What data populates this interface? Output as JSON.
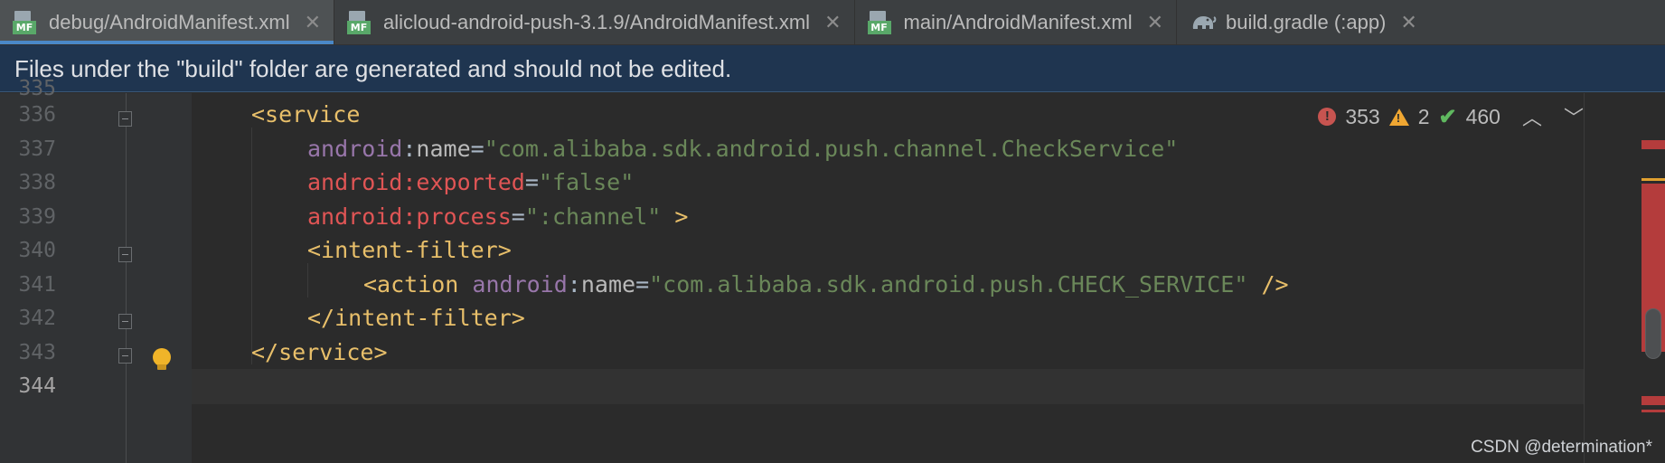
{
  "tabs": [
    {
      "label": "debug/AndroidManifest.xml",
      "icon": "manifest-file-icon",
      "active": true
    },
    {
      "label": "alicloud-android-push-3.1.9/AndroidManifest.xml",
      "icon": "manifest-file-icon",
      "active": false
    },
    {
      "label": "main/AndroidManifest.xml",
      "icon": "manifest-file-icon",
      "active": false
    },
    {
      "label": "build.gradle (:app)",
      "icon": "gradle-elephant-icon",
      "active": false
    }
  ],
  "tab_icon_badge": "MF",
  "close_glyph": "✕",
  "banner": {
    "text": "Files under the \"build\" folder are generated and should not be edited."
  },
  "line_numbers": [
    "335",
    "336",
    "337",
    "338",
    "339",
    "340",
    "341",
    "342",
    "343",
    "344"
  ],
  "code": {
    "l336": {
      "tag": "<service"
    },
    "l337": {
      "ns": "android",
      "colon": ":",
      "attr": "name",
      "eq": "=",
      "val": "\"com.alibaba.sdk.android.push.channel.CheckService\""
    },
    "l338": {
      "err": "android:exported",
      "eq": "=",
      "val": "\"false\""
    },
    "l339": {
      "err": "android:process",
      "eq": "=",
      "val": "\":channel\"",
      "close": " >"
    },
    "l340": {
      "tag": "<intent-filter>"
    },
    "l341": {
      "tag": "<action ",
      "ns": "android",
      "colon": ":",
      "attr": "name",
      "eq": "=",
      "val": "\"com.alibaba.sdk.android.push.CHECK_SERVICE\"",
      "close": " />"
    },
    "l342": {
      "tag": "</intent-filter>"
    },
    "l343": {
      "tag": "</service>"
    }
  },
  "inspections": {
    "errors": "353",
    "warnings": "2",
    "ok": "460"
  },
  "colors": {
    "accent": "#4a88c7",
    "error": "#c75450",
    "warning": "#f0a732",
    "ok": "#5fb85f",
    "banner": "#1f3550"
  },
  "watermark": "CSDN @determination*"
}
